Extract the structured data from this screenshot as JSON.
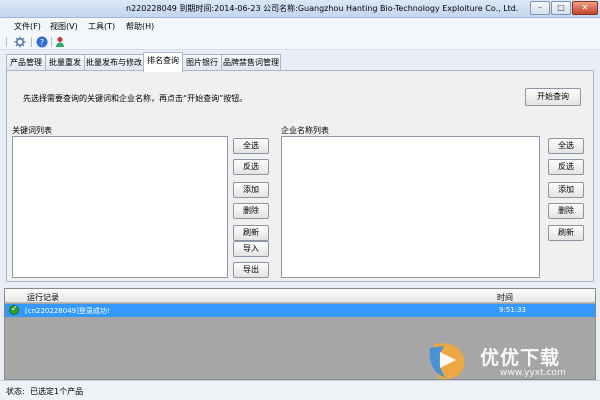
{
  "window": {
    "title": "n220228049  到期时间:2014-06-23    公司名称:Guangzhou Hanting Bio-Technology Exploiture Co., Ltd."
  },
  "menu": [
    "文件(F)",
    "视图(V)",
    "工具(T)",
    "帮助(H)"
  ],
  "toolbar": {
    "icons": [
      "settings-icon",
      "help-icon",
      "user-icon"
    ]
  },
  "tabs": [
    "产品管理",
    "批量重发",
    "批量发布与修改",
    "排名查询",
    "图片银行",
    "品牌禁售词管理"
  ],
  "active_tab": "排名查询",
  "ranking": {
    "hint": "先选择需要查询的关键词和企业名称，再点击“开始查询”按钮。",
    "start_button": "开始查询",
    "keyword_list_label": "关键词列表",
    "company_list_label": "企业名称列表",
    "keyword_buttons": [
      "全选",
      "反选",
      "添加",
      "删除",
      "刷新",
      "导入",
      "导出"
    ],
    "company_buttons": [
      "全选",
      "反选",
      "添加",
      "删除",
      "刷新"
    ]
  },
  "log": {
    "col_record": "运行记录",
    "col_time": "时间",
    "rows": [
      {
        "message": "[cn220228049]登录成功!",
        "time": "9:51:33",
        "status": "success"
      }
    ]
  },
  "status": {
    "label": "状态:",
    "value": "已选定1个产品"
  },
  "watermark": {
    "text": "优优下载",
    "url": "www.yyxt.com"
  },
  "colors": {
    "selection": "#3399ff",
    "log_background": "#a6a6a6"
  }
}
